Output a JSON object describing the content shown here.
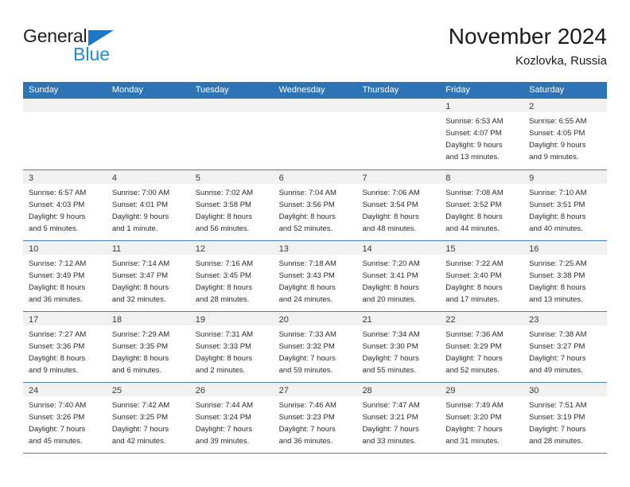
{
  "logo": {
    "word_top": "General",
    "word_bottom": "Blue",
    "triangle_icon": "triangle-icon",
    "accent_color": "#1f8ad6"
  },
  "header": {
    "title": "November 2024",
    "subtitle": "Kozlovka, Russia"
  },
  "theme": {
    "header_blue": "#2e74b5",
    "grid_line": "#4a7ebb",
    "day_band": "#f1f1f1"
  },
  "weekdays": [
    "Sunday",
    "Monday",
    "Tuesday",
    "Wednesday",
    "Thursday",
    "Friday",
    "Saturday"
  ],
  "weeks": [
    [
      {
        "day": "",
        "empty": true
      },
      {
        "day": "",
        "empty": true
      },
      {
        "day": "",
        "empty": true
      },
      {
        "day": "",
        "empty": true
      },
      {
        "day": "",
        "empty": true
      },
      {
        "day": "1",
        "sunrise": "Sunrise: 6:53 AM",
        "sunset": "Sunset: 4:07 PM",
        "daylight_1": "Daylight: 9 hours",
        "daylight_2": "and 13 minutes."
      },
      {
        "day": "2",
        "sunrise": "Sunrise: 6:55 AM",
        "sunset": "Sunset: 4:05 PM",
        "daylight_1": "Daylight: 9 hours",
        "daylight_2": "and 9 minutes."
      }
    ],
    [
      {
        "day": "3",
        "sunrise": "Sunrise: 6:57 AM",
        "sunset": "Sunset: 4:03 PM",
        "daylight_1": "Daylight: 9 hours",
        "daylight_2": "and 5 minutes."
      },
      {
        "day": "4",
        "sunrise": "Sunrise: 7:00 AM",
        "sunset": "Sunset: 4:01 PM",
        "daylight_1": "Daylight: 9 hours",
        "daylight_2": "and 1 minute."
      },
      {
        "day": "5",
        "sunrise": "Sunrise: 7:02 AM",
        "sunset": "Sunset: 3:58 PM",
        "daylight_1": "Daylight: 8 hours",
        "daylight_2": "and 56 minutes."
      },
      {
        "day": "6",
        "sunrise": "Sunrise: 7:04 AM",
        "sunset": "Sunset: 3:56 PM",
        "daylight_1": "Daylight: 8 hours",
        "daylight_2": "and 52 minutes."
      },
      {
        "day": "7",
        "sunrise": "Sunrise: 7:06 AM",
        "sunset": "Sunset: 3:54 PM",
        "daylight_1": "Daylight: 8 hours",
        "daylight_2": "and 48 minutes."
      },
      {
        "day": "8",
        "sunrise": "Sunrise: 7:08 AM",
        "sunset": "Sunset: 3:52 PM",
        "daylight_1": "Daylight: 8 hours",
        "daylight_2": "and 44 minutes."
      },
      {
        "day": "9",
        "sunrise": "Sunrise: 7:10 AM",
        "sunset": "Sunset: 3:51 PM",
        "daylight_1": "Daylight: 8 hours",
        "daylight_2": "and 40 minutes."
      }
    ],
    [
      {
        "day": "10",
        "sunrise": "Sunrise: 7:12 AM",
        "sunset": "Sunset: 3:49 PM",
        "daylight_1": "Daylight: 8 hours",
        "daylight_2": "and 36 minutes."
      },
      {
        "day": "11",
        "sunrise": "Sunrise: 7:14 AM",
        "sunset": "Sunset: 3:47 PM",
        "daylight_1": "Daylight: 8 hours",
        "daylight_2": "and 32 minutes."
      },
      {
        "day": "12",
        "sunrise": "Sunrise: 7:16 AM",
        "sunset": "Sunset: 3:45 PM",
        "daylight_1": "Daylight: 8 hours",
        "daylight_2": "and 28 minutes."
      },
      {
        "day": "13",
        "sunrise": "Sunrise: 7:18 AM",
        "sunset": "Sunset: 3:43 PM",
        "daylight_1": "Daylight: 8 hours",
        "daylight_2": "and 24 minutes."
      },
      {
        "day": "14",
        "sunrise": "Sunrise: 7:20 AM",
        "sunset": "Sunset: 3:41 PM",
        "daylight_1": "Daylight: 8 hours",
        "daylight_2": "and 20 minutes."
      },
      {
        "day": "15",
        "sunrise": "Sunrise: 7:22 AM",
        "sunset": "Sunset: 3:40 PM",
        "daylight_1": "Daylight: 8 hours",
        "daylight_2": "and 17 minutes."
      },
      {
        "day": "16",
        "sunrise": "Sunrise: 7:25 AM",
        "sunset": "Sunset: 3:38 PM",
        "daylight_1": "Daylight: 8 hours",
        "daylight_2": "and 13 minutes."
      }
    ],
    [
      {
        "day": "17",
        "sunrise": "Sunrise: 7:27 AM",
        "sunset": "Sunset: 3:36 PM",
        "daylight_1": "Daylight: 8 hours",
        "daylight_2": "and 9 minutes."
      },
      {
        "day": "18",
        "sunrise": "Sunrise: 7:29 AM",
        "sunset": "Sunset: 3:35 PM",
        "daylight_1": "Daylight: 8 hours",
        "daylight_2": "and 6 minutes."
      },
      {
        "day": "19",
        "sunrise": "Sunrise: 7:31 AM",
        "sunset": "Sunset: 3:33 PM",
        "daylight_1": "Daylight: 8 hours",
        "daylight_2": "and 2 minutes."
      },
      {
        "day": "20",
        "sunrise": "Sunrise: 7:33 AM",
        "sunset": "Sunset: 3:32 PM",
        "daylight_1": "Daylight: 7 hours",
        "daylight_2": "and 59 minutes."
      },
      {
        "day": "21",
        "sunrise": "Sunrise: 7:34 AM",
        "sunset": "Sunset: 3:30 PM",
        "daylight_1": "Daylight: 7 hours",
        "daylight_2": "and 55 minutes."
      },
      {
        "day": "22",
        "sunrise": "Sunrise: 7:36 AM",
        "sunset": "Sunset: 3:29 PM",
        "daylight_1": "Daylight: 7 hours",
        "daylight_2": "and 52 minutes."
      },
      {
        "day": "23",
        "sunrise": "Sunrise: 7:38 AM",
        "sunset": "Sunset: 3:27 PM",
        "daylight_1": "Daylight: 7 hours",
        "daylight_2": "and 49 minutes."
      }
    ],
    [
      {
        "day": "24",
        "sunrise": "Sunrise: 7:40 AM",
        "sunset": "Sunset: 3:26 PM",
        "daylight_1": "Daylight: 7 hours",
        "daylight_2": "and 45 minutes."
      },
      {
        "day": "25",
        "sunrise": "Sunrise: 7:42 AM",
        "sunset": "Sunset: 3:25 PM",
        "daylight_1": "Daylight: 7 hours",
        "daylight_2": "and 42 minutes."
      },
      {
        "day": "26",
        "sunrise": "Sunrise: 7:44 AM",
        "sunset": "Sunset: 3:24 PM",
        "daylight_1": "Daylight: 7 hours",
        "daylight_2": "and 39 minutes."
      },
      {
        "day": "27",
        "sunrise": "Sunrise: 7:46 AM",
        "sunset": "Sunset: 3:23 PM",
        "daylight_1": "Daylight: 7 hours",
        "daylight_2": "and 36 minutes."
      },
      {
        "day": "28",
        "sunrise": "Sunrise: 7:47 AM",
        "sunset": "Sunset: 3:21 PM",
        "daylight_1": "Daylight: 7 hours",
        "daylight_2": "and 33 minutes."
      },
      {
        "day": "29",
        "sunrise": "Sunrise: 7:49 AM",
        "sunset": "Sunset: 3:20 PM",
        "daylight_1": "Daylight: 7 hours",
        "daylight_2": "and 31 minutes."
      },
      {
        "day": "30",
        "sunrise": "Sunrise: 7:51 AM",
        "sunset": "Sunset: 3:19 PM",
        "daylight_1": "Daylight: 7 hours",
        "daylight_2": "and 28 minutes."
      }
    ]
  ]
}
